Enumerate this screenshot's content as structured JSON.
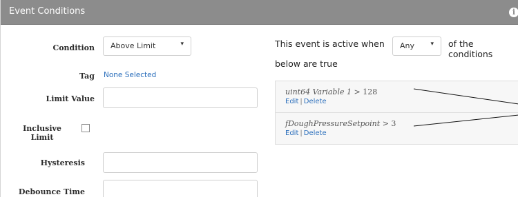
{
  "header": {
    "title": "Event Conditions",
    "info_icon": "info-icon",
    "background": "#8c8c8c"
  },
  "form": {
    "condition_label": "Condition",
    "condition_value": "Above Limit",
    "tag_label": "Tag",
    "tag_value": "None Selected",
    "limit_value_label": "Limit Value",
    "limit_value": "",
    "inclusive_label_line1": "Inclusive",
    "inclusive_label_line2": "Limit",
    "inclusive_checked": false,
    "hysteresis_label": "Hysteresis",
    "hysteresis_value": "",
    "debounce_label": "Debounce Time",
    "debounce_value": ""
  },
  "activity": {
    "prefix": "This event is active when",
    "mode": "Any",
    "suffix": "of the conditions",
    "line2": "below are true"
  },
  "conditions": [
    {
      "variable": "uint64 Variable 1",
      "expr": " > 128",
      "edit": "Edit",
      "sep": "|",
      "delete": "Delete"
    },
    {
      "variable": "fDoughPressureSetpoint",
      "expr": " > 3",
      "edit": "Edit",
      "sep": "|",
      "delete": "Delete"
    }
  ],
  "colors": {
    "link": "#2a6ebb",
    "header": "#8c8c8c"
  }
}
